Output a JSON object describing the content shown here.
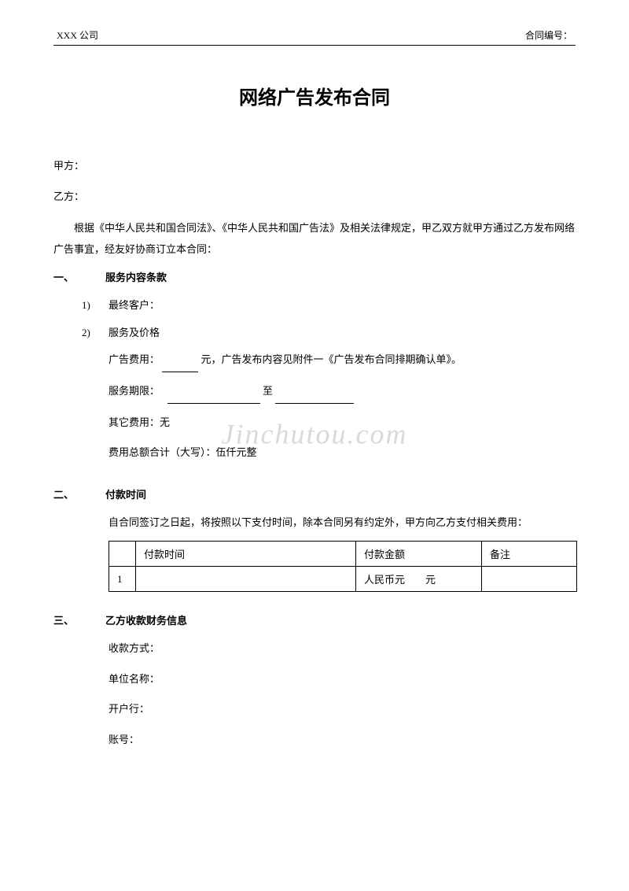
{
  "header": {
    "company": "XXX 公司",
    "contract_no_label": "合同编号："
  },
  "title": "网络广告发布合同",
  "parties": {
    "a_label": "甲方：",
    "b_label": "乙方："
  },
  "intro": "根据《中华人民共和国合同法》、《中华人民共和国广告法》及相关法律规定，甲乙双方就甲方通过乙方发布网络广告事宜，经友好协商订立本合同：",
  "sections": {
    "s1": {
      "num": "一、",
      "title": "服务内容条款",
      "items": [
        {
          "num": "1)",
          "text": "最终客户："
        },
        {
          "num": "2)",
          "text": "服务及价格"
        }
      ],
      "details": {
        "ad_fee_prefix": "广告费用：",
        "ad_fee_suffix": " 元，广告发布内容见附件一《广告发布合同排期确认单》。",
        "period_prefix": "服务期限：",
        "period_mid": " 至 ",
        "other_fee": "其它费用：无",
        "total": "费用总额合计（大写）：伍仟元整"
      }
    },
    "s2": {
      "num": "二、",
      "title": "付款时间",
      "body": "自合同签订之日起，将按照以下支付时间，除本合同另有约定外，甲方向乙方支付相关费用：",
      "table": {
        "headers": [
          "",
          "付款时间",
          "付款金额",
          "备注"
        ],
        "rows": [
          {
            "idx": "1",
            "time": "",
            "amount": "人民币元  元",
            "note": ""
          }
        ]
      }
    },
    "s3": {
      "num": "三、",
      "title": "乙方收款财务信息",
      "lines": [
        "收款方式：",
        "单位名称：",
        "开户行：",
        "账号："
      ]
    }
  },
  "watermark": "Jinchutou.com"
}
